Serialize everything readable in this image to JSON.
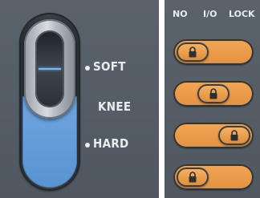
{
  "knee": {
    "label": "KNEE",
    "options": [
      "SOFT",
      "HARD"
    ],
    "accent": "#5a93d2"
  },
  "lock_panel": {
    "headers": [
      "NO",
      "I/O",
      "LOCK"
    ],
    "rows": [
      {
        "state": "NO",
        "icon": "lock-icon"
      },
      {
        "state": "I/O",
        "icon": "lock-icon"
      },
      {
        "state": "LOCK",
        "icon": "lock-icon"
      },
      {
        "state": "NO",
        "icon": "lock-icon"
      }
    ],
    "accent": "#e3913f"
  }
}
